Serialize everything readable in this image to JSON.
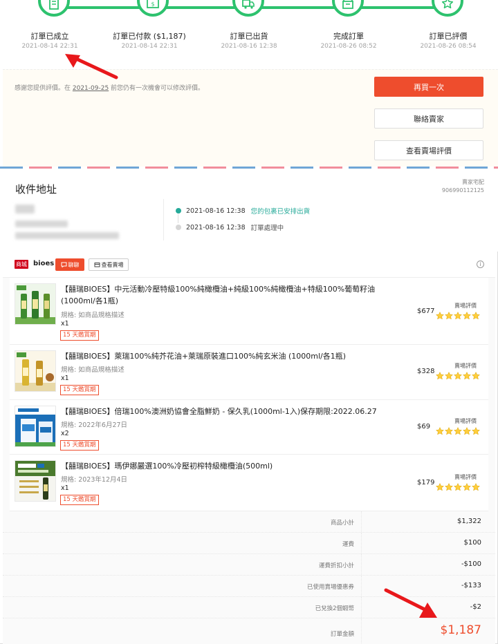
{
  "progress_steps": [
    {
      "label": "訂單已成立",
      "time": "2021-08-14 22:31",
      "icon": "receipt-icon"
    },
    {
      "label": "訂單已付款 ($1,187)",
      "time": "2021-08-14 22:31",
      "icon": "payment-icon"
    },
    {
      "label": "訂單已出貨",
      "time": "2021-08-16 12:38",
      "icon": "truck-icon"
    },
    {
      "label": "完成訂單",
      "time": "2021-08-26 08:52",
      "icon": "box-icon"
    },
    {
      "label": "訂單已評價",
      "time": "2021-08-26 08:54",
      "icon": "star-icon"
    }
  ],
  "review_note": {
    "prefix": "感謝您提供評價。在 ",
    "date": "2021-09-25",
    "suffix": " 前您仍有一次機會可以修改評價。"
  },
  "actions": {
    "buy_again": "再買一次",
    "contact_seller": "聯絡賣家",
    "view_shop_rating": "查看賣場評價"
  },
  "address": {
    "title": "收件地址",
    "carrier": "賣家宅配",
    "tracking_number": "906990112125",
    "logistics": [
      {
        "time": "2021-08-16 12:38",
        "status": "您的包裹已安排出貨",
        "active": true
      },
      {
        "time": "2021-08-16 12:38",
        "status": "訂單處理中",
        "active": false
      }
    ]
  },
  "shop": {
    "badge": "商城",
    "name": "bioes",
    "chat_label": "聊聊",
    "view_shop_label": "查看賣場"
  },
  "items": [
    {
      "title": "【囍瑞BIOES】中元活動冷壓特級100%純橄欖油+純級100%純橄欖油+特級100%葡萄籽油(1000ml/各1瓶)",
      "variation": "規格: 如商品規格描述",
      "qty": "x1",
      "tag": "15 天鑑賞期",
      "price": "$677",
      "rating_label": "賣場評價",
      "rating": 5
    },
    {
      "title": "【囍瑞BIOES】萊瑞100%純芥花油+萊瑞原裝進口100%純玄米油 (1000ml/各1瓶)",
      "variation": "規格: 如商品規格描述",
      "qty": "x1",
      "tag": "15 天鑑賞期",
      "price": "$328",
      "rating_label": "賣場評價",
      "rating": 5
    },
    {
      "title": "【囍瑞BIOES】倍瑞100%澳洲奶協會全脂鮮奶 - 保久乳(1000ml-1入)保存期限:2022.06.27",
      "variation": "規格: 2022年6月27日",
      "qty": "x2",
      "tag": "15 天鑑賞期",
      "price": "$69",
      "rating_label": "賣場評價",
      "rating": 5
    },
    {
      "title": "【囍瑞BIOES】瑪伊娜嚴選100%冷壓初榨特級橄欖油(500ml)",
      "variation": "規格: 2023年12月4日",
      "qty": "x1",
      "tag": "15 天鑑賞期",
      "price": "$179",
      "rating_label": "賣場評價",
      "rating": 5
    }
  ],
  "summary": [
    {
      "label": "商品小計",
      "value": "$1,322"
    },
    {
      "label": "運費",
      "value": "$100"
    },
    {
      "label": "運費折扣小計",
      "value": "-$100"
    },
    {
      "label": "已使用賣場優惠券",
      "value": "-$133"
    },
    {
      "label": "已兌換2個蝦幣",
      "value": "-$2"
    },
    {
      "label": "訂單金額",
      "value": "$1,187"
    }
  ],
  "colors": {
    "accent": "#ee4d2d",
    "progress": "#2dc26e",
    "star": "#ffce3d",
    "annotation_arrow": "#e8181b"
  }
}
